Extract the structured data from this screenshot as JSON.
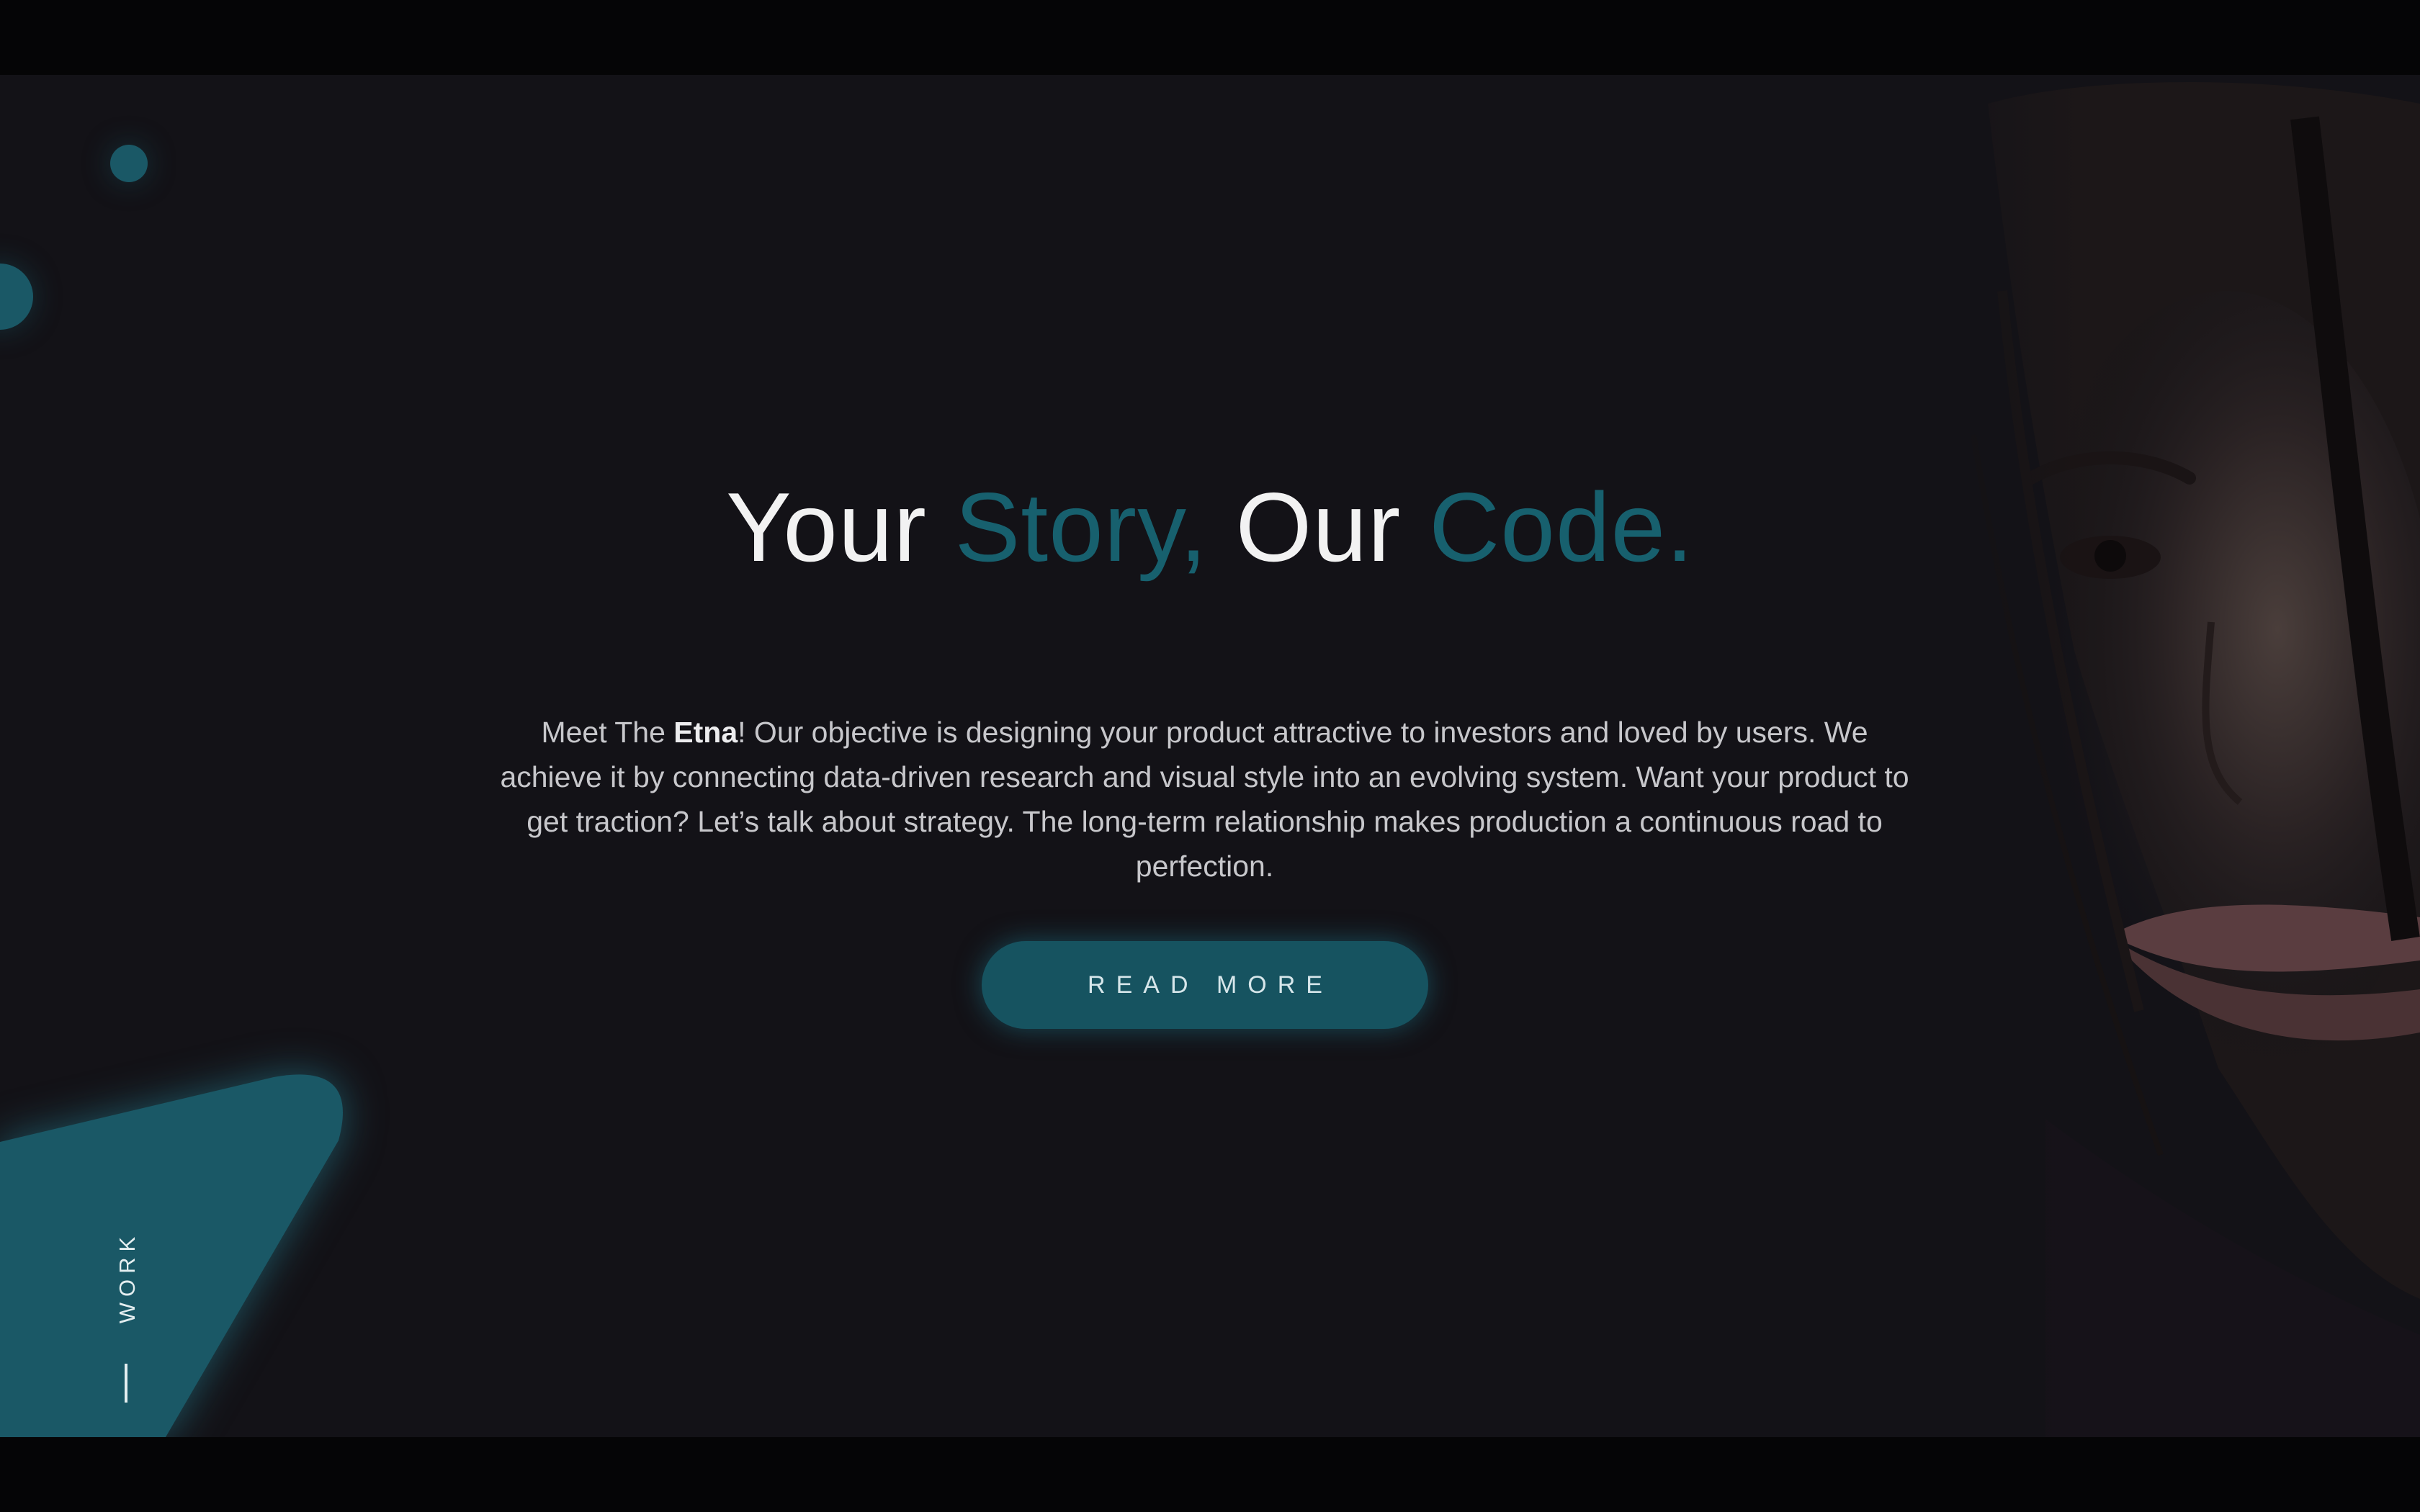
{
  "hero": {
    "headline": {
      "part1": "Your ",
      "accent1": "Story,",
      "part2": " Our ",
      "accent2": "Code."
    },
    "body": {
      "intro": "Meet The ",
      "brand": "Etna",
      "rest": "! Our objective is designing your product attractive to investors and loved by users.  We achieve it by connecting data-driven research and visual style into an evolving system. Want your product to get traction? Let’s talk about strategy.  The long-term relationship makes production a continuous road to perfection."
    },
    "button_label": "READ MORE"
  },
  "side_nav": {
    "label": "WORK"
  },
  "colors": {
    "background": "#131217",
    "letterbox": "#050506",
    "accent": "#17606e",
    "teal_shape": "#1a5866",
    "button": "#165360",
    "headline_text": "#f2f2f2",
    "body_text": "#c7c7cb"
  }
}
